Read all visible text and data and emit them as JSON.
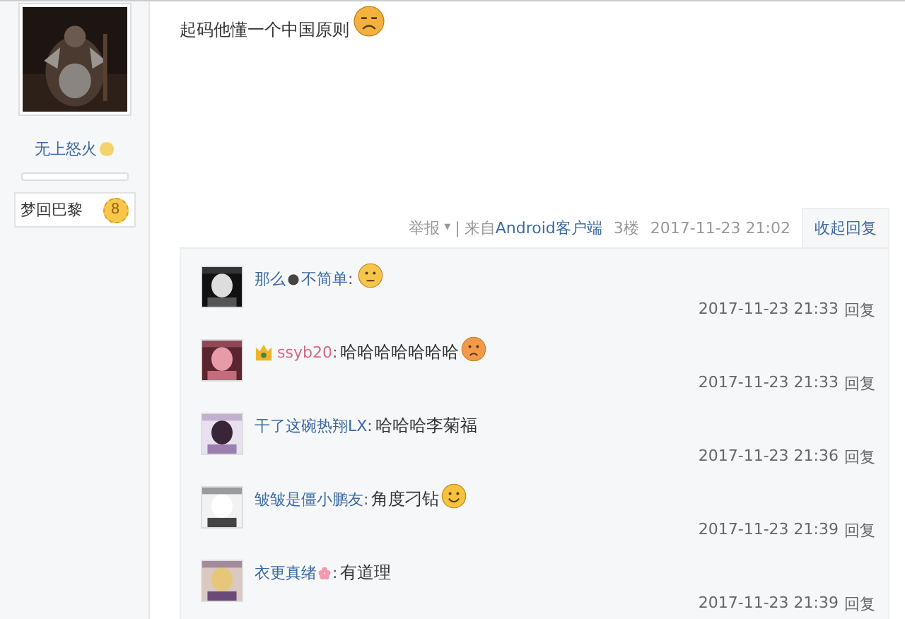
{
  "author": {
    "name": "无上怒火",
    "badge_name": "梦回巴黎",
    "badge_level": "8"
  },
  "post": {
    "text": "起码他懂一个中国原则",
    "emoji": true
  },
  "footer": {
    "report": "举报",
    "caret": "▾",
    "separator": "|",
    "from": "来自",
    "client": "Android客户端",
    "floor": "3楼",
    "time": "2017-11-23 21:02",
    "collapse": "收起回复"
  },
  "replies": [
    {
      "name": "那么",
      "name_icon": {
        "kind": "bomb"
      },
      "name_after": "不简单",
      "vip": false,
      "colon": ":",
      "emoji": true,
      "time": "2017-11-23 21:33",
      "reply": "回复"
    },
    {
      "name": "ssyb20",
      "vip": true,
      "colon": ":",
      "text": "哈哈哈哈哈哈哈",
      "emoji": true,
      "time": "2017-11-23 21:33",
      "reply": "回复"
    },
    {
      "name": "干了这碗热翔LX",
      "vip": false,
      "colon": ":",
      "text": "哈哈哈李菊福",
      "time": "2017-11-23 21:36",
      "reply": "回复"
    },
    {
      "name": "皱皱是僵小鹏友",
      "vip": false,
      "colon": ":",
      "text": "角度刁钻",
      "emoji": true,
      "time": "2017-11-23 21:39",
      "reply": "回复"
    },
    {
      "name": "衣更真绪",
      "name_icon": {
        "kind": "flower"
      },
      "vip": false,
      "colon": ":",
      "text": "有道理",
      "time": "2017-11-23 21:39",
      "reply": "回复"
    }
  ]
}
